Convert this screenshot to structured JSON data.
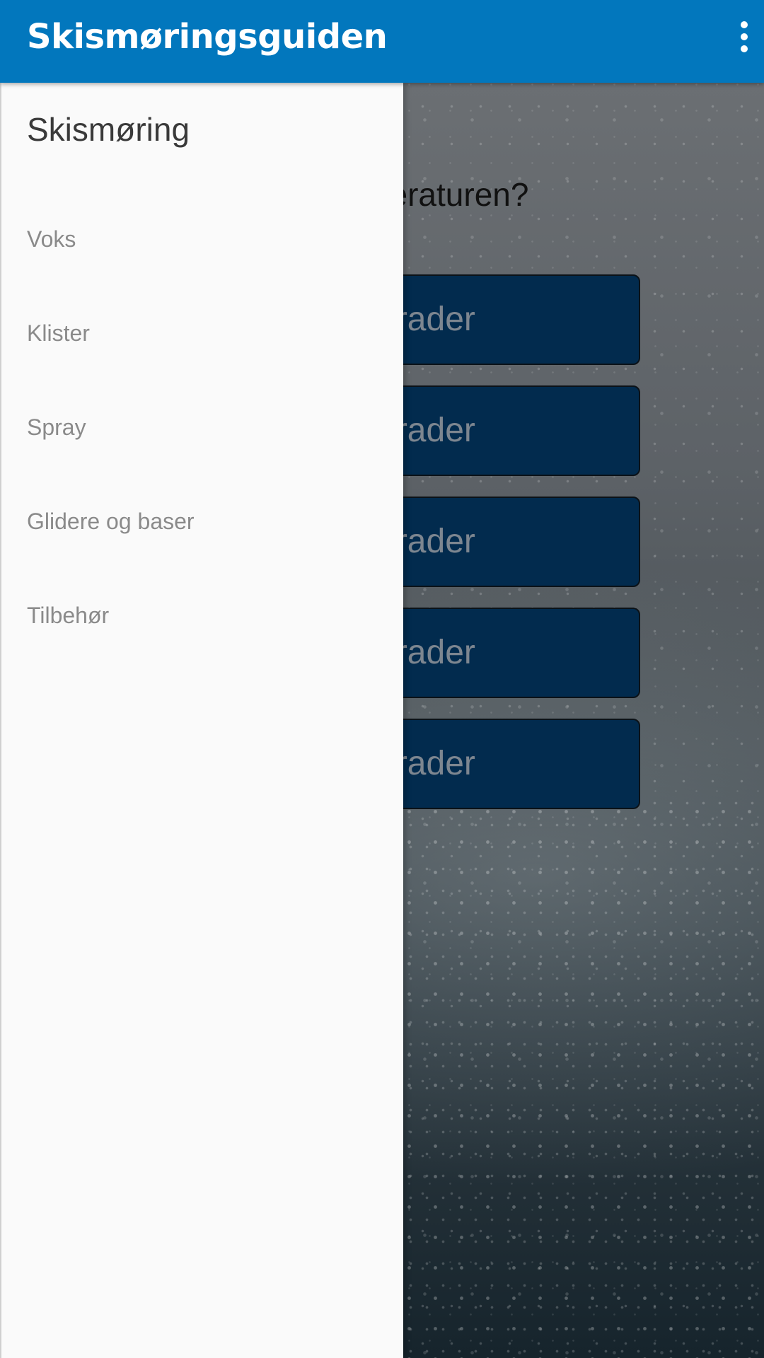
{
  "app_bar": {
    "title": "Skismøringsguiden",
    "overflow_icon": "more-vert-icon",
    "color": "#0277bd"
  },
  "background": {
    "question": "Hva er temperaturen?",
    "question_visible": "s\neraturen?",
    "buttons": [
      {
        "label": "grader"
      },
      {
        "label": "grader"
      },
      {
        "label": "grader"
      },
      {
        "label": "grader"
      },
      {
        "label": "grader"
      }
    ],
    "button_color": "#022b4e"
  },
  "drawer": {
    "title": "Skismøring",
    "items": [
      {
        "label": "Voks"
      },
      {
        "label": "Klister"
      },
      {
        "label": "Spray"
      },
      {
        "label": "Glidere og baser"
      },
      {
        "label": "Tilbehør"
      }
    ]
  }
}
